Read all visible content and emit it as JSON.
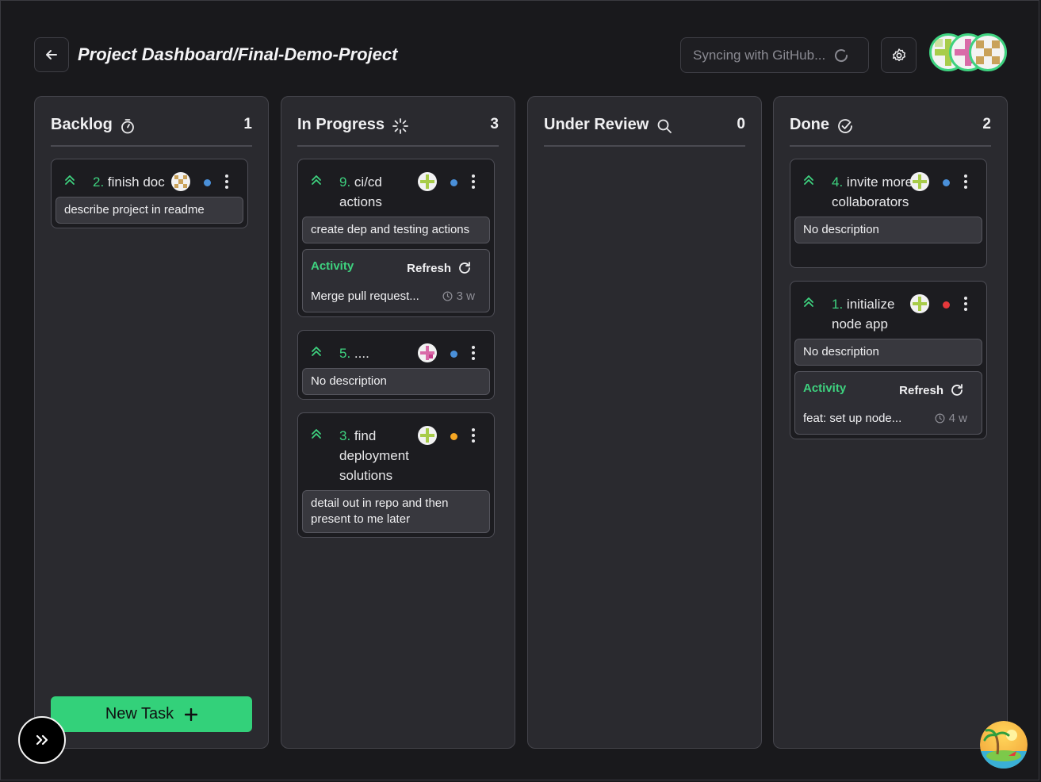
{
  "header": {
    "title": "Project Dashboard/Final-Demo-Project",
    "sync_text": "Syncing with GitHub...",
    "back_icon": "arrow-left-icon",
    "settings_icon": "gear-icon"
  },
  "colors": {
    "accent": "#33d17a",
    "dot_blue": "#4a90d9",
    "dot_orange": "#f5a623",
    "dot_red": "#e5383b"
  },
  "columns": [
    {
      "title": "Backlog",
      "count": "1",
      "icon": "timer-icon",
      "cards": [
        {
          "num": "2.",
          "title": "finish doc",
          "description": "describe project in readme"
        }
      ]
    },
    {
      "title": "In Progress",
      "count": "3",
      "icon": "loader-icon",
      "cards": [
        {
          "num": "9.",
          "title": "ci/cd actions",
          "description": "create dep and testing actions",
          "activity": {
            "label": "Activity",
            "refresh": "Refresh",
            "message": "Merge pull request...",
            "time": "3 w"
          }
        },
        {
          "num": "5.",
          "title": "....",
          "description": "No description"
        },
        {
          "num": "3.",
          "title": "find deployment solutions",
          "description": "detail out in repo and then present to me later"
        }
      ]
    },
    {
      "title": "Under Review",
      "count": "0",
      "icon": "search-icon",
      "cards": []
    },
    {
      "title": "Done",
      "count": "2",
      "icon": "check-circle-icon",
      "cards": [
        {
          "num": "4.",
          "title": "invite more collaborators",
          "description": "No description"
        },
        {
          "num": "1.",
          "title": "initialize node app",
          "description": "No description",
          "activity": {
            "label": "Activity",
            "refresh": "Refresh",
            "message": "feat: set up node...",
            "time": "4 w"
          }
        }
      ]
    }
  ],
  "footer": {
    "new_task_label": "New Task"
  }
}
